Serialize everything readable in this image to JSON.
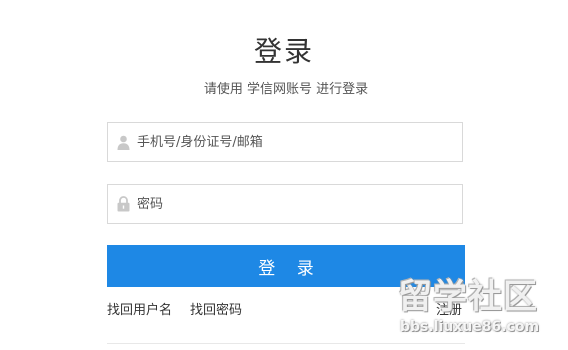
{
  "header": {
    "title": "登录",
    "subtitle": "请使用 学信网账号 进行登录"
  },
  "form": {
    "username": {
      "placeholder": "手机号/身份证号/邮箱",
      "value": "",
      "icon": "user-icon"
    },
    "password": {
      "placeholder": "密码",
      "value": "",
      "icon": "lock-icon"
    },
    "submit_label": "登 录"
  },
  "links": {
    "recover_username": "找回用户名",
    "recover_password": "找回密码",
    "register": "注册"
  },
  "watermark": {
    "text": "留学社区",
    "url": "bbs.liuxue86.com"
  },
  "colors": {
    "accent": "#1e88e5",
    "border": "#d9d9d9",
    "text": "#333333"
  }
}
